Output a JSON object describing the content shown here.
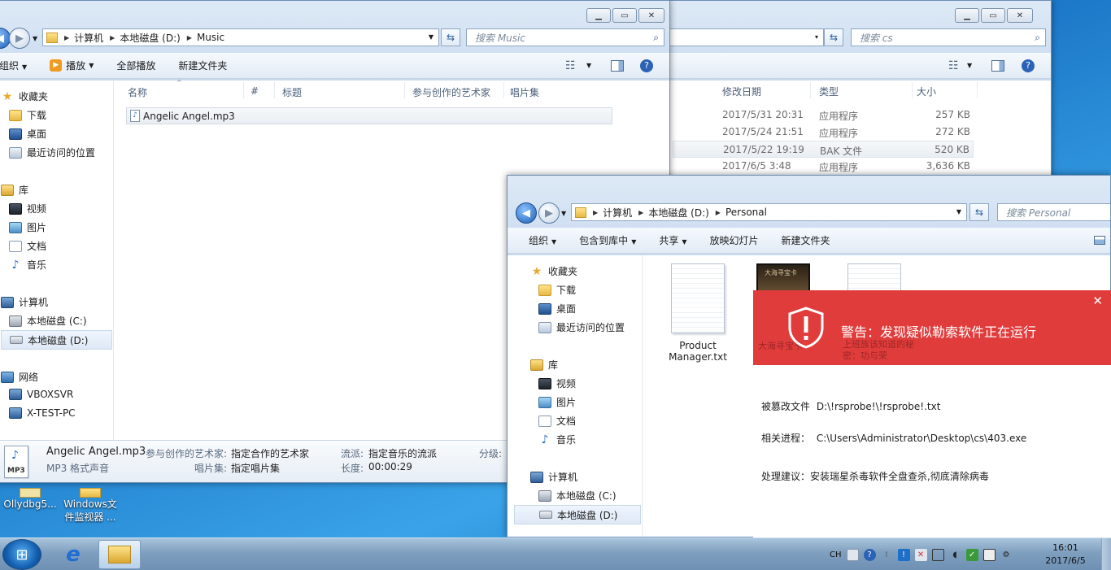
{
  "back_window": {
    "address_dropdown": "▾",
    "search_placeholder": "搜索 cs",
    "toolbar": {
      "view_icon": "☷"
    },
    "columns": [
      "修改日期",
      "类型",
      "大小"
    ],
    "rows": [
      {
        "date": "2017/5/31 20:31",
        "type": "应用程序",
        "size": "257 KB"
      },
      {
        "date": "2017/5/24 21:51",
        "type": "应用程序",
        "size": "272 KB"
      },
      {
        "date": "2017/5/22 19:19",
        "type": "BAK 文件",
        "size": "520 KB"
      },
      {
        "date": "2017/6/5 3:48",
        "type": "应用程序",
        "size": "3,636 KB"
      }
    ]
  },
  "music_window": {
    "breadcrumb": [
      "计算机",
      "本地磁盘 (D:)",
      "Music"
    ],
    "search_placeholder": "搜索 Music",
    "toolbar": {
      "organize": "组织",
      "play": "播放",
      "play_all": "全部播放",
      "new_folder": "新建文件夹"
    },
    "nav": {
      "favorites": "收藏夹",
      "downloads": "下载",
      "desktop": "桌面",
      "recent": "最近访问的位置",
      "libraries": "库",
      "videos": "视频",
      "pictures": "图片",
      "documents": "文档",
      "music": "音乐",
      "computer": "计算机",
      "drive_c": "本地磁盘 (C:)",
      "drive_d": "本地磁盘 (D:)",
      "network": "网络",
      "vboxsvr": "VBOXSVR",
      "xtestpc": "X-TEST-PC"
    },
    "columns": [
      "名称",
      "#",
      "标题",
      "参与创作的艺术家",
      "唱片集"
    ],
    "files": [
      {
        "name": "Angelic Angel.mp3"
      }
    ],
    "details": {
      "filename": "Angelic Angel.mp3",
      "filetype": "MP3 格式声音",
      "thumb_label": "MP3",
      "artist_label": "参与创作的艺术家:",
      "artist_value": "指定合作的艺术家",
      "album_label": "唱片集:",
      "album_value": "指定唱片集",
      "genre_label": "流派:",
      "genre_value": "指定音乐的流派",
      "length_label": "长度:",
      "length_value": "00:00:29",
      "rating_label": "分级:"
    }
  },
  "personal_window": {
    "breadcrumb": [
      "计算机",
      "本地磁盘 (D:)",
      "Personal"
    ],
    "search_placeholder": "搜索 Personal",
    "toolbar": {
      "organize": "组织",
      "include": "包含到库中",
      "share": "共享",
      "slideshow": "放映幻灯片",
      "new_folder": "新建文件夹"
    },
    "nav": {
      "favorites": "收藏夹",
      "downloads": "下载",
      "desktop": "桌面",
      "recent": "最近访问的位置",
      "libraries": "库",
      "videos": "视频",
      "pictures": "图片",
      "documents": "文档",
      "music": "音乐",
      "computer": "计算机",
      "drive_c": "本地磁盘 (C:)",
      "drive_d": "本地磁盘 (D:)"
    },
    "files": [
      {
        "name_line1": "Product",
        "name_line2": "Manager.txt"
      },
      {
        "name": "大海寻宝卡",
        "cover_text": "大海寻宝卡"
      },
      {
        "name": "上班族该知道的秘密：功与荣"
      }
    ]
  },
  "alert": {
    "title": "警告：发现疑似勒索软件正在运行",
    "file_label": "被篡改文件",
    "file_value": "D:\\!rsprobe!\\!rsprobe!.txt",
    "process_label": "相关进程：",
    "process_value": "C:\\Users\\Administrator\\Desktop\\cs\\403.exe",
    "advice_label": "处理建议：",
    "advice_value": "安装瑞星杀毒软件全盘查杀,彻底清除病毒",
    "close_glyph": "✕",
    "accent": "#e03c3c"
  },
  "desktop": {
    "icons": [
      {
        "label": "Ollydbg5..."
      },
      {
        "label_line1": "Windows文",
        "label_line2": "件监视器 ..."
      }
    ]
  },
  "taskbar": {
    "lang": "CH",
    "time": "16:01",
    "date": "2017/6/5"
  }
}
